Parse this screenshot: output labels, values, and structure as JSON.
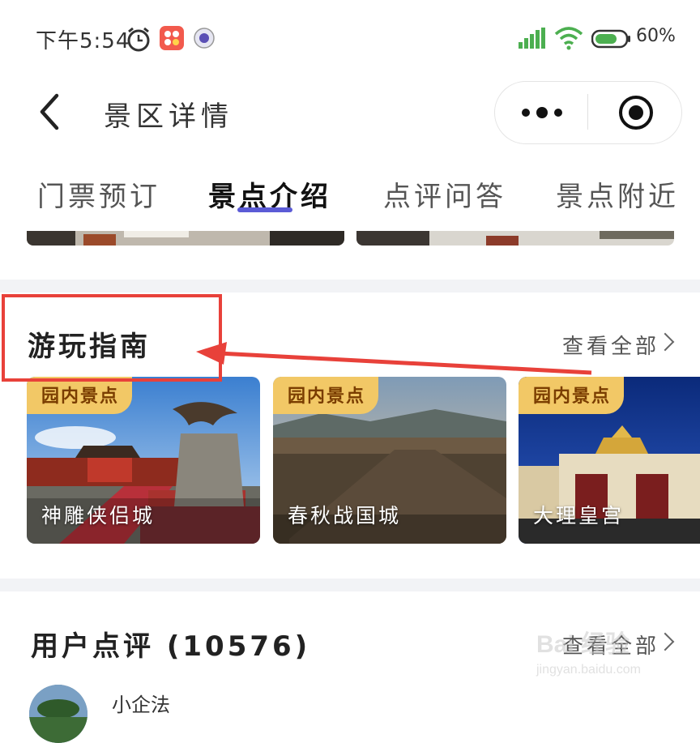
{
  "status_bar": {
    "time": "下午5:54",
    "battery": "60%",
    "icons": [
      "alarm-icon",
      "app-icon",
      "camera-app-icon",
      "signal-icon",
      "wifi-icon",
      "battery-icon"
    ]
  },
  "nav": {
    "title": "景区详情",
    "more_icon": "more-dots-icon",
    "capture_icon": "record-circle-icon"
  },
  "tabs": [
    {
      "label": "门票预订",
      "active": false
    },
    {
      "label": "景点介绍",
      "active": true
    },
    {
      "label": "点评问答",
      "active": false
    },
    {
      "label": "景点附近",
      "active": false
    }
  ],
  "guide": {
    "title": "游玩指南",
    "see_all": "查看全部",
    "cards": [
      {
        "tag": "园内景点",
        "name": "神雕侠侣城"
      },
      {
        "tag": "园内景点",
        "name": "春秋战国城"
      },
      {
        "tag": "园内景点",
        "name": "大理皇宫"
      }
    ]
  },
  "reviews": {
    "title": "用户点评 (10576)",
    "see_all": "查看全部",
    "first_reviewer": "小企法"
  },
  "watermark": {
    "logo": "Bai 经验",
    "url": "jingyan.baidu.com"
  },
  "colors": {
    "accent_underline": "#5b5bd6",
    "annotation_red": "#e8413a",
    "tag_bg": "#f2c866",
    "section_gap": "#f2f3f6"
  }
}
